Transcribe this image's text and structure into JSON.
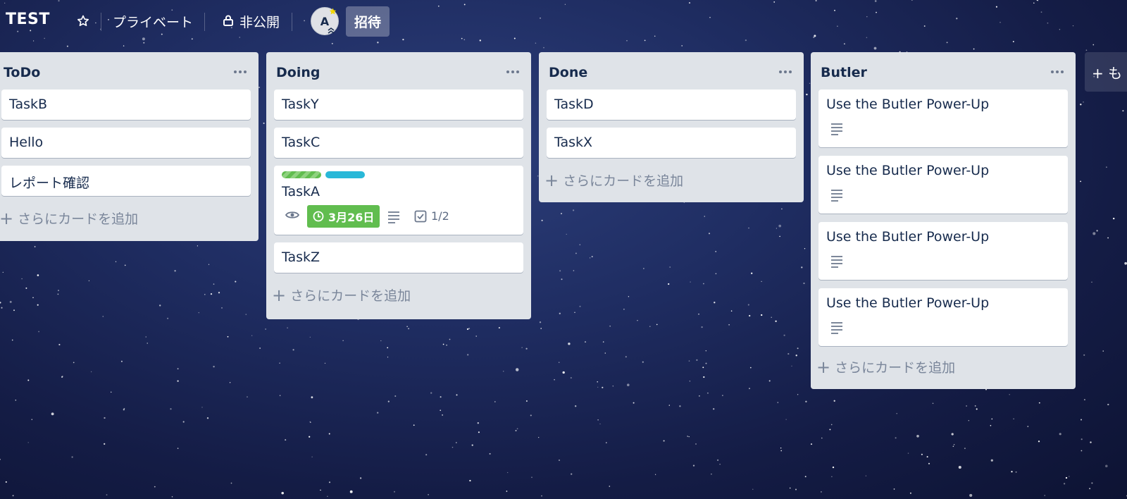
{
  "header": {
    "board_title": "TEST",
    "visibility_label": "プライベート",
    "privacy_label": "非公開",
    "avatar_initial": "A",
    "invite_label": "招待"
  },
  "lists": [
    {
      "title": "ToDo",
      "cards": [
        {
          "title": "TaskB"
        },
        {
          "title": "Hello"
        },
        {
          "title": "レポート確認"
        }
      ],
      "add_card_label": "さらにカードを追加"
    },
    {
      "title": "Doing",
      "cards": [
        {
          "title": "TaskY"
        },
        {
          "title": "TaskC"
        },
        {
          "title": "TaskA",
          "labels": [
            "green-striped",
            "sky"
          ],
          "due_date": "3月26日",
          "checklist": "1/2"
        },
        {
          "title": "TaskZ"
        }
      ],
      "add_card_label": "さらにカードを追加"
    },
    {
      "title": "Done",
      "cards": [
        {
          "title": "TaskD"
        },
        {
          "title": "TaskX"
        }
      ],
      "add_card_label": "さらにカードを追加"
    },
    {
      "title": "Butler",
      "cards": [
        {
          "title": "Use the Butler Power-Up"
        },
        {
          "title": "Use the Butler Power-Up"
        },
        {
          "title": "Use the Butler Power-Up"
        },
        {
          "title": "Use the Butler Power-Up"
        }
      ],
      "add_card_label": "さらにカードを追加"
    }
  ],
  "add_list_label": "+ も",
  "colors": {
    "list_bg": "#dfe3e8",
    "due_badge": "#61bd4f",
    "label_green": "#61bd4f",
    "label_sky": "#29b8d8",
    "muted_text": "#7a869a"
  }
}
